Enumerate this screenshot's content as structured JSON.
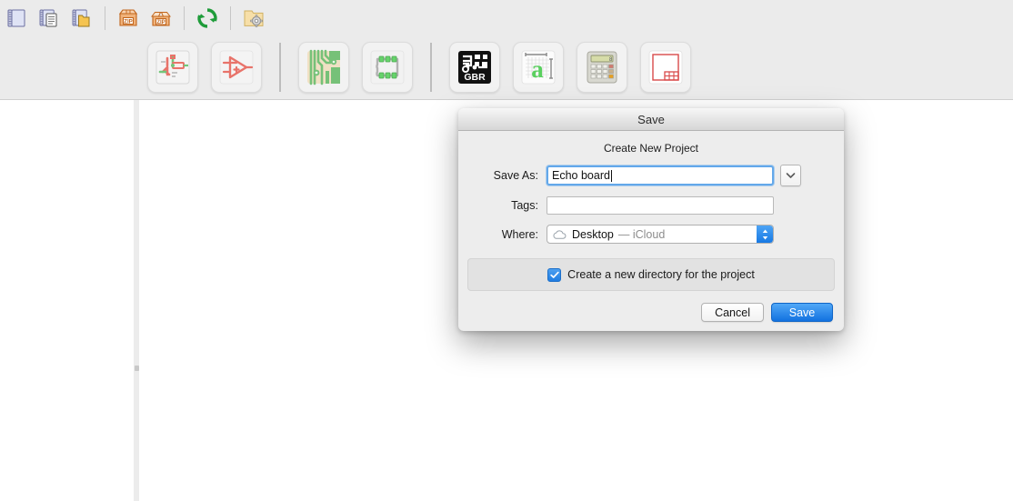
{
  "window": {
    "background_color": "#ffffff"
  },
  "toolbar_top": {
    "buttons": [
      {
        "name": "new-project-icon",
        "tooltip": "New Project"
      },
      {
        "name": "new-project-from-template-icon",
        "tooltip": "New Project from Template"
      },
      {
        "name": "open-project-icon",
        "tooltip": "Open Project"
      },
      {
        "name": "archive-project-zip-icon",
        "tooltip": "Archive Project"
      },
      {
        "name": "unarchive-project-zip-icon",
        "tooltip": "Unarchive Project"
      },
      {
        "name": "refresh-icon",
        "tooltip": "Refresh Project Tree"
      },
      {
        "name": "open-project-directory-icon",
        "tooltip": "Open Project Directory"
      }
    ],
    "separators_after": [
      2,
      4,
      5
    ]
  },
  "toolbar_second": {
    "buttons": [
      {
        "name": "schematic-editor-icon",
        "label": "Schematic Editor"
      },
      {
        "name": "symbol-editor-icon",
        "label": "Symbol Editor"
      },
      {
        "name": "pcb-editor-icon",
        "label": "PCB Editor"
      },
      {
        "name": "footprint-editor-icon",
        "label": "Footprint Editor"
      },
      {
        "name": "gerber-viewer-icon",
        "label": "Gerber Viewer"
      },
      {
        "name": "image-converter-icon",
        "label": "Image Converter"
      },
      {
        "name": "calculator-icon",
        "label": "Calculator Tools"
      },
      {
        "name": "drawing-sheet-editor-icon",
        "label": "Drawing Sheet Editor"
      }
    ],
    "separators_after": [
      1,
      3
    ]
  },
  "dialog": {
    "title": "Save",
    "subtitle": "Create New Project",
    "fields": {
      "save_as": {
        "label": "Save As:",
        "value": "Echo board",
        "placeholder": ""
      },
      "tags": {
        "label": "Tags:",
        "value": "",
        "placeholder": ""
      },
      "where": {
        "label": "Where:",
        "value": "Desktop",
        "value_suffix": "— iCloud",
        "icon": "cloud-icon"
      }
    },
    "checkbox": {
      "label": "Create a new directory for the project",
      "checked": true
    },
    "buttons": {
      "cancel": "Cancel",
      "save": "Save"
    },
    "accent_color": "#1272e0",
    "focus_ring_color": "#63a8ea"
  }
}
